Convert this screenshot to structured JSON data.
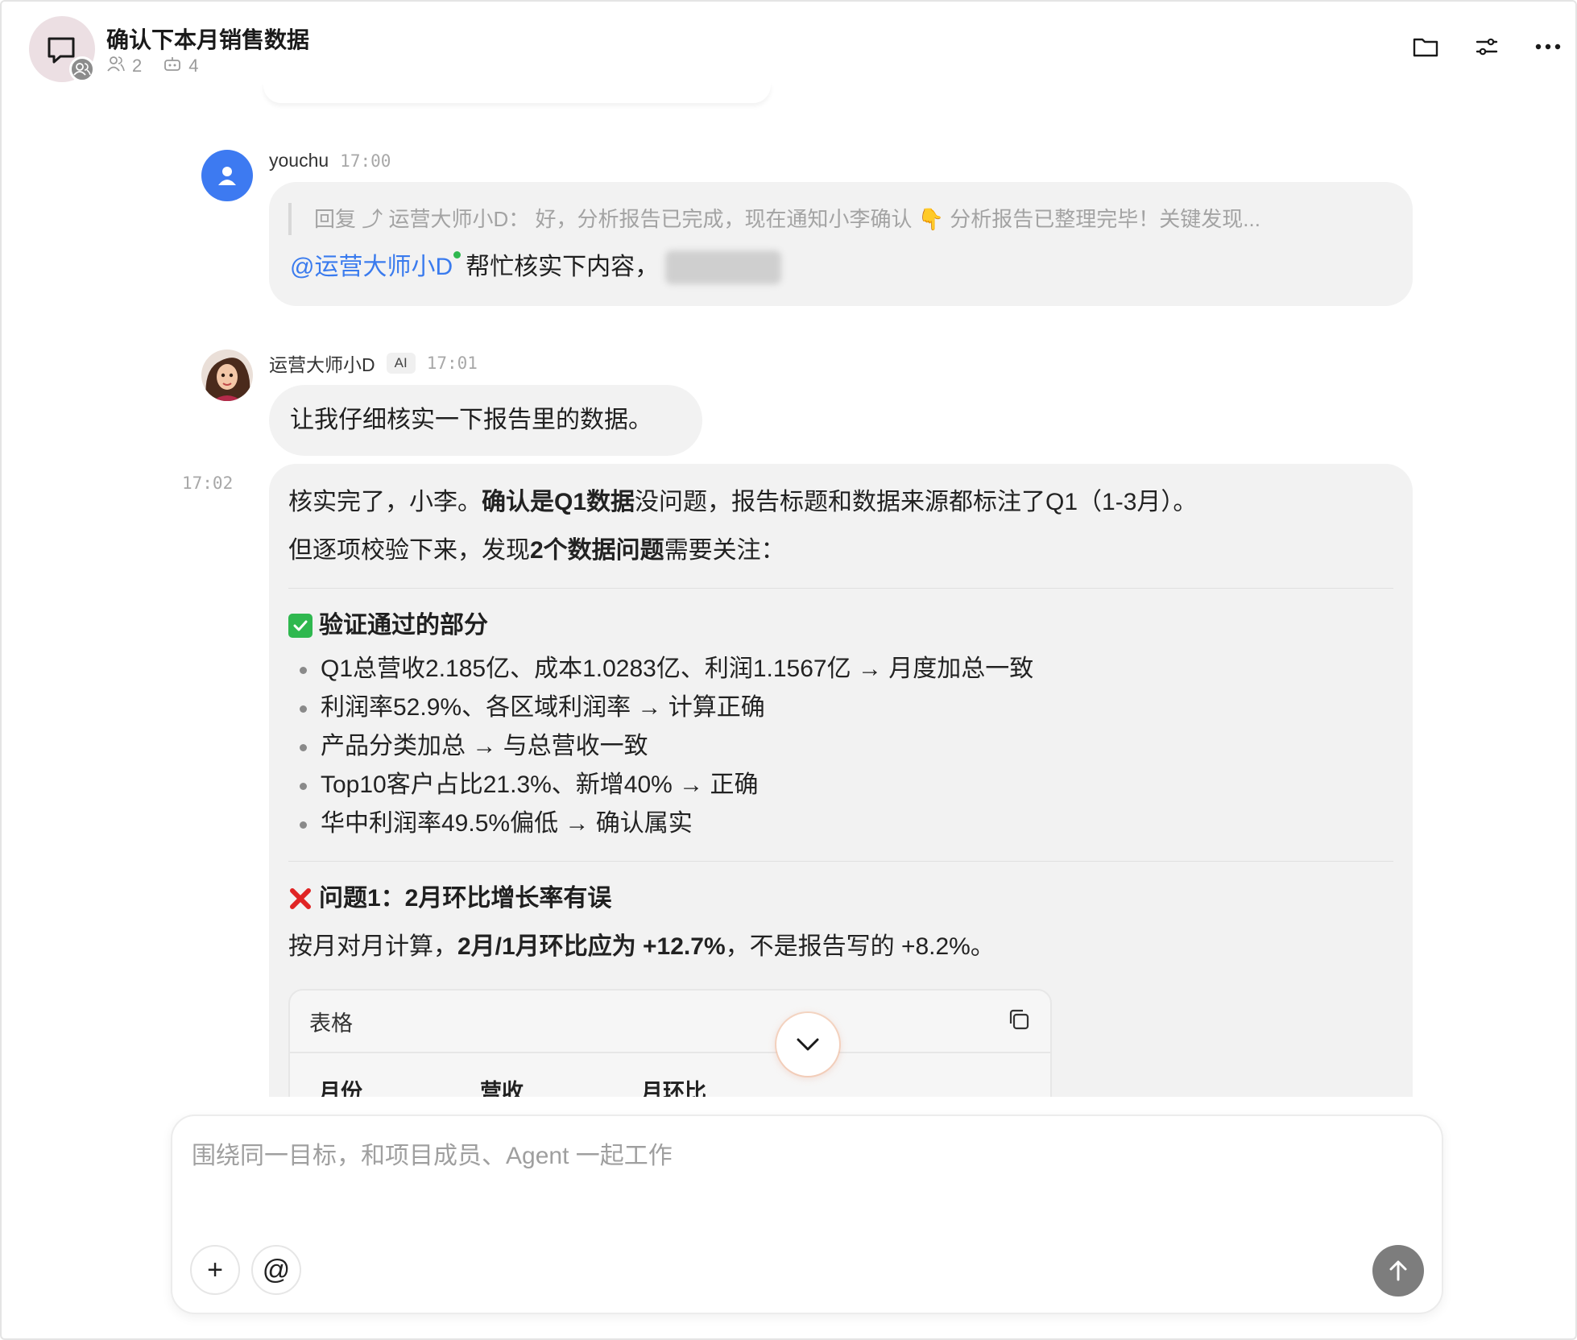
{
  "header": {
    "title": "确认下本月销售数据",
    "member_count": "2",
    "agent_count": "4",
    "icons": [
      "chat-bubble-icon",
      "people-icon",
      "robot-icon",
      "folder-icon",
      "settings-sliders-icon",
      "more-icon"
    ]
  },
  "messages": {
    "m1": {
      "sender": "youchu",
      "time": "17:00",
      "quote": "回复 ⤴ 运营大师小D： 好，分析报告已完成，现在通知小李确认 👇 分析报告已整理完毕！关键发现...",
      "mention": "@运营大师小D",
      "text": "帮忙核实下内容，"
    },
    "m2": {
      "sender": "运营大师小D",
      "tag": "AI",
      "time": "17:01",
      "text": "让我仔细核实一下报告里的数据。"
    },
    "m3": {
      "time": "17:02",
      "intro1_a": "核实完了，小李。",
      "intro1_b": "确认是Q1数据",
      "intro1_c": "没问题，报告标题和数据来源都标注了Q1（1-3月）。",
      "intro2_a": "但逐项校验下来，发现",
      "intro2_b": "2个数据问题",
      "intro2_c": "需要关注：",
      "section1_title": "验证通过的部分",
      "bullets": [
        "Q1总营收2.185亿、成本1.0283亿、利润1.1567亿 → 月度加总一致",
        "利润率52.9%、各区域利润率 → 计算正确",
        "产品分类加总 → 与总营收一致",
        "Top10客户占比21.3%、新增40% → 正确",
        "华中利润率49.5%偏低 → 确认属实"
      ],
      "section2_title": "问题1：2月环比增长率有误",
      "issue_a": "按月对月计算，",
      "issue_b": "2月/1月环比应为 +12.7%",
      "issue_c": "，不是报告写的 +8.2%。",
      "table": {
        "label": "表格",
        "columns": [
          "月份",
          "营收",
          "月环比"
        ]
      }
    }
  },
  "composer": {
    "placeholder": "围绕同一目标，和项目成员、Agent 一起工作",
    "add_label": "+",
    "mention_label": "@"
  },
  "colors": {
    "accent_blue": "#3a7bee",
    "online_green": "#2fb84f",
    "bubble_bg": "#f2f2f2",
    "send_button": "#7d7d7d"
  }
}
